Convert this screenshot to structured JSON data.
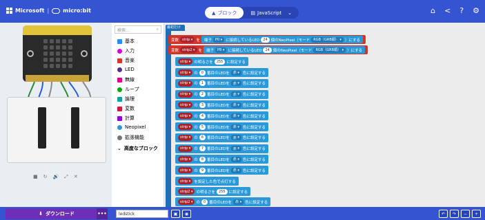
{
  "header": {
    "brand": "Microsoft",
    "separator": "|",
    "product": "micro:bit",
    "modes": [
      {
        "label": "ブロック",
        "active": true
      },
      {
        "label": "JavaScript",
        "active": false
      }
    ],
    "icons": [
      "home-icon",
      "share-icon",
      "help-icon",
      "settings-icon"
    ]
  },
  "toolbox": {
    "search_placeholder": "検索...",
    "categories": [
      {
        "label": "基本",
        "color": "#1e90ff"
      },
      {
        "label": "入力",
        "color": "#d400d4"
      },
      {
        "label": "音楽",
        "color": "#e63022"
      },
      {
        "label": "LED",
        "color": "#5c2d91"
      },
      {
        "label": "無線",
        "color": "#e3008c"
      },
      {
        "label": "ループ",
        "color": "#00aa00"
      },
      {
        "label": "論理",
        "color": "#00a4a6"
      },
      {
        "label": "変数",
        "color": "#dc143c"
      },
      {
        "label": "計算",
        "color": "#9400d3"
      },
      {
        "label": "Neopixel",
        "color": "#2b98d8"
      },
      {
        "label": "拡張機能",
        "color": "#777777"
      },
      {
        "label": "高度なブロック",
        "color": "#333333"
      }
    ]
  },
  "workspace": {
    "start_label": "最初だけ",
    "var_lines": [
      {
        "prefix": "変数",
        "var": "strip",
        "op": "を",
        "pin_label": "端子",
        "pin": "P0",
        "mid": "に接続しているLED",
        "count": "24",
        "suffix": "個のNeoPixel（モード",
        "mode": "RGB（GRB順）",
        "end": "）にする"
      },
      {
        "prefix": "変数",
        "var": "strip2",
        "op": "を",
        "pin_label": "端子",
        "pin": "P8",
        "mid": "に接続しているLED",
        "count": "24",
        "suffix": "個のNeoPixel（モード",
        "mode": "RGB（GRB順）",
        "end": "）にする"
      }
    ],
    "brightness": {
      "var": "strip",
      "label": "の明るさを",
      "value": "255",
      "end": "に設定する"
    },
    "pixel_rows": [
      {
        "var": "strip",
        "index": "0",
        "color": "赤"
      },
      {
        "var": "strip",
        "index": "1",
        "color": "赤"
      },
      {
        "var": "strip",
        "index": "2",
        "color": "赤"
      },
      {
        "var": "strip",
        "index": "3",
        "color": "赤"
      },
      {
        "var": "strip",
        "index": "4",
        "color": "赤"
      },
      {
        "var": "strip",
        "index": "5",
        "color": "赤"
      },
      {
        "var": "strip",
        "index": "6",
        "color": "赤"
      },
      {
        "var": "strip",
        "index": "7",
        "color": "赤"
      },
      {
        "var": "strip",
        "index": "8",
        "color": "赤"
      },
      {
        "var": "strip",
        "index": "9",
        "color": "赤"
      }
    ],
    "pixel_text": {
      "of": "の",
      "mid": "番目のLEDを",
      "end": "色に設定する"
    },
    "show": {
      "var": "strip",
      "label": "を設定した色で点灯する"
    },
    "brightness2": {
      "var": "strip2",
      "label": "の明るさを",
      "value": "255",
      "end": "に設定する"
    },
    "last_row": {
      "var": "strip2",
      "index": "0",
      "color": "赤"
    }
  },
  "simulator": {
    "controls": [
      "■",
      "↻",
      "🔊",
      "⤢",
      "✕"
    ]
  },
  "bottom": {
    "download_label": "ダウンロード",
    "more_label": "•••",
    "project_name": "ledstick",
    "right_buttons": [
      "↶",
      "↷",
      "−",
      "+"
    ]
  }
}
